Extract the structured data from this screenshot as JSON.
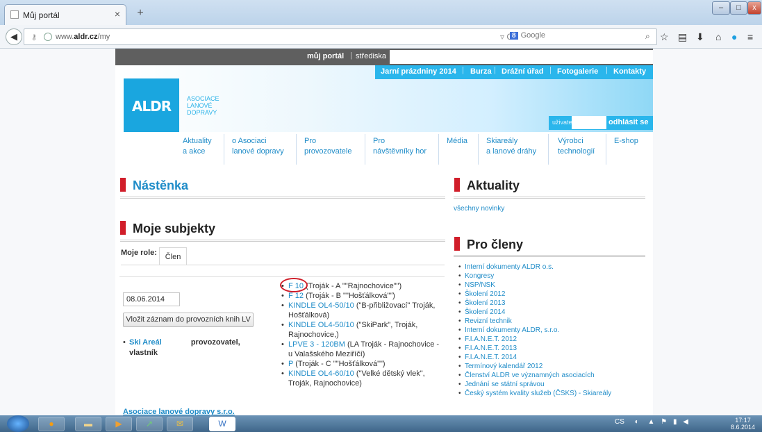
{
  "browser": {
    "tab_title": "Můj portál",
    "new_tab": "+",
    "window_buttons": {
      "minimize": "–",
      "maximize": "□",
      "close": "x"
    },
    "url_host_prefix": "www.",
    "url_host": "aldr.cz",
    "url_path": "/my",
    "search_engine": "8",
    "search_placeholder": "Google",
    "icons": [
      "back-icon",
      "lock-icon",
      "globe-icon",
      "reload-icon",
      "search-icon",
      "star-icon",
      "reading-list-icon",
      "download-icon",
      "home-icon",
      "skype-icon",
      "menu-icon"
    ]
  },
  "site": {
    "top_bar": {
      "portal": "můj portál",
      "separator": "|",
      "centers": "střediska"
    },
    "top_nav": [
      "Jarní prázdniny 2014",
      "Burza",
      "Drážní úřad",
      "Fotogalerie",
      "Kontakty"
    ],
    "logo_text": "ALDR",
    "logo_sub": [
      "ASOCIACE",
      "LANOVÉ",
      "DOPRAVY"
    ],
    "login": {
      "label": "uživatel",
      "logout": "odhlásit se"
    },
    "main_nav": [
      {
        "line1": "Aktuality",
        "line2": "a akce"
      },
      {
        "line1": "o Asociaci",
        "line2": "lanové dopravy"
      },
      {
        "line1": "Pro",
        "line2": "provozovatele"
      },
      {
        "line1": "Pro",
        "line2": "návštěvníky hor"
      },
      {
        "line1": "Média",
        "line2": ""
      },
      {
        "line1": "Skiareály",
        "line2": "a lanové dráhy"
      },
      {
        "line1": "Výrobci",
        "line2": "technologií"
      },
      {
        "line1": "E-shop",
        "line2": ""
      }
    ]
  },
  "left": {
    "board_title": "Nástěnka",
    "subjects_title": "Moje subjekty",
    "role_label": "Moje role:",
    "role_tab": "Člen",
    "date_value": "08.06.2014",
    "add_record_button": "Vložit záznam do provozních knih LV",
    "skiareal": {
      "link": "Ski Areál",
      "role": "provozovatel,",
      "role2": "vlastník"
    },
    "books": [
      {
        "link": "F 10",
        "text": " (Troják - A \"\"Rajnochovice\"\")"
      },
      {
        "link": "F 12",
        "text": " (Troják - B \"\"Hošťálková\"\")"
      },
      {
        "link": "KINDLE OL4-50/10",
        "text": " (\"B-přibližovací\" Troják, Hošťálková)"
      },
      {
        "link": "KINDLE OL4-50/10",
        "text": " (\"SkiPark\", Troják, Rajnochovice,)"
      },
      {
        "link": "LPVE 3 - 120BM",
        "text": " (LA Troják - Rajnochovice - u Valašského Meziříčí)"
      },
      {
        "link": "P",
        "text": " (Troják - C \"\"Hošťálková\"\")"
      },
      {
        "link": "KINDLE OL4-60/10",
        "text": " (\"Velké dětský vlek\", Troják, Rajnochovice)"
      }
    ],
    "footer_link": "Asociace lanové dopravy s.r.o."
  },
  "right": {
    "news_title": "Aktuality",
    "all_news": "všechny novinky",
    "members_title": "Pro členy",
    "members_items": [
      "Interní dokumenty ALDR o.s.",
      "Kongresy",
      "NSP/NSK",
      "Školení 2012",
      "Školení 2013",
      "Školení 2014",
      "Revizní technik",
      "Interní dokumenty ALDR, s.r.o.",
      "F.I.A.N.E.T. 2012",
      "F.I.A.N.E.T. 2013",
      "F.I.A.N.E.T. 2014",
      "Termínový kalendář 2012",
      "Členství ALDR ve významných asociacích",
      "Jednání se státní správou",
      "Český systém kvality služeb (ČSKS) - Skiareály"
    ]
  },
  "taskbar": {
    "apps": [
      "ie-icon",
      "firefox-icon",
      "explorer-icon",
      "media-icon",
      "chart-icon",
      "outlook-icon",
      "word-icon"
    ],
    "lang": "CS",
    "time": "17:17",
    "date": "8.6.2014"
  },
  "colors": {
    "accent": "#2ab6ec",
    "brand_red": "#d11e2a",
    "link": "#1f8cc8"
  }
}
